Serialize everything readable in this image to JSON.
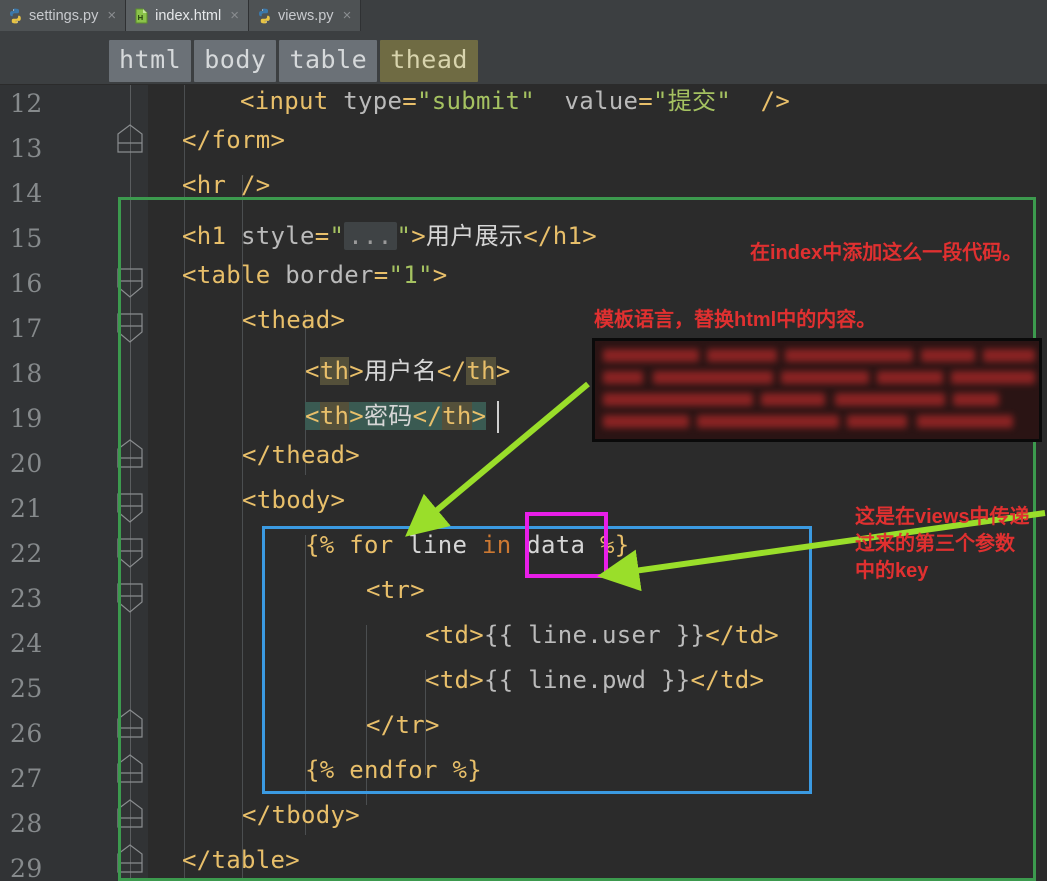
{
  "window": {
    "app": "PyCharm code editor",
    "theme_bg": "#2b2b2b"
  },
  "tabs": [
    {
      "label": "settings.py",
      "icon": "python-file-icon",
      "close": "×",
      "active": false
    },
    {
      "label": "index.html",
      "icon": "html-file-icon",
      "close": "×",
      "active": true
    },
    {
      "label": "views.py",
      "icon": "python-file-icon",
      "close": "×",
      "active": false
    }
  ],
  "breadcrumb": {
    "items": [
      {
        "label": "html",
        "selected": false
      },
      {
        "label": "body",
        "selected": false
      },
      {
        "label": "table",
        "selected": false
      },
      {
        "label": "thead",
        "selected": true
      }
    ]
  },
  "editor": {
    "language": "HTML",
    "current_line": 19,
    "lines": [
      {
        "num": "12",
        "text": "<input type=\"submit\" value=\"提交\" />"
      },
      {
        "num": "13",
        "text": "</form>"
      },
      {
        "num": "14",
        "text": "<hr />"
      },
      {
        "num": "15",
        "text": "<h1 style=\"...\">用户展示</h1>"
      },
      {
        "num": "16",
        "text": "<table border=\"1\">"
      },
      {
        "num": "17",
        "text": "<thead>"
      },
      {
        "num": "18",
        "text": "<th>用户名</th>"
      },
      {
        "num": "19",
        "text": "<th>密码</th>"
      },
      {
        "num": "20",
        "text": "</thead>"
      },
      {
        "num": "21",
        "text": "<tbody>"
      },
      {
        "num": "22",
        "text": "{% for line in data %}"
      },
      {
        "num": "23",
        "text": "<tr>"
      },
      {
        "num": "24",
        "text": "<td>{{ line.user }}</td>"
      },
      {
        "num": "25",
        "text": "<td>{{ line.pwd }}</td>"
      },
      {
        "num": "26",
        "text": "</tr>"
      },
      {
        "num": "27",
        "text": "{% endfor %}"
      },
      {
        "num": "28",
        "text": "</tbody>"
      },
      {
        "num": "29",
        "text": "</table>"
      }
    ],
    "fold_placeholder": "..."
  },
  "annotations": {
    "note_top": "在index中添加这么一段代码。",
    "note_mid": "模板语言，替换html中的内容。",
    "note_right_l1": "这是在views中传递",
    "note_right_l2": "过来的第三个参数",
    "note_right_l3": "中的key",
    "colors": {
      "green_box": "#3c9a4e",
      "blue_box": "#3b9ae1",
      "magenta_box": "#e81ee8",
      "arrow_green": "#9ade2a",
      "note_red": "#e03030"
    }
  }
}
